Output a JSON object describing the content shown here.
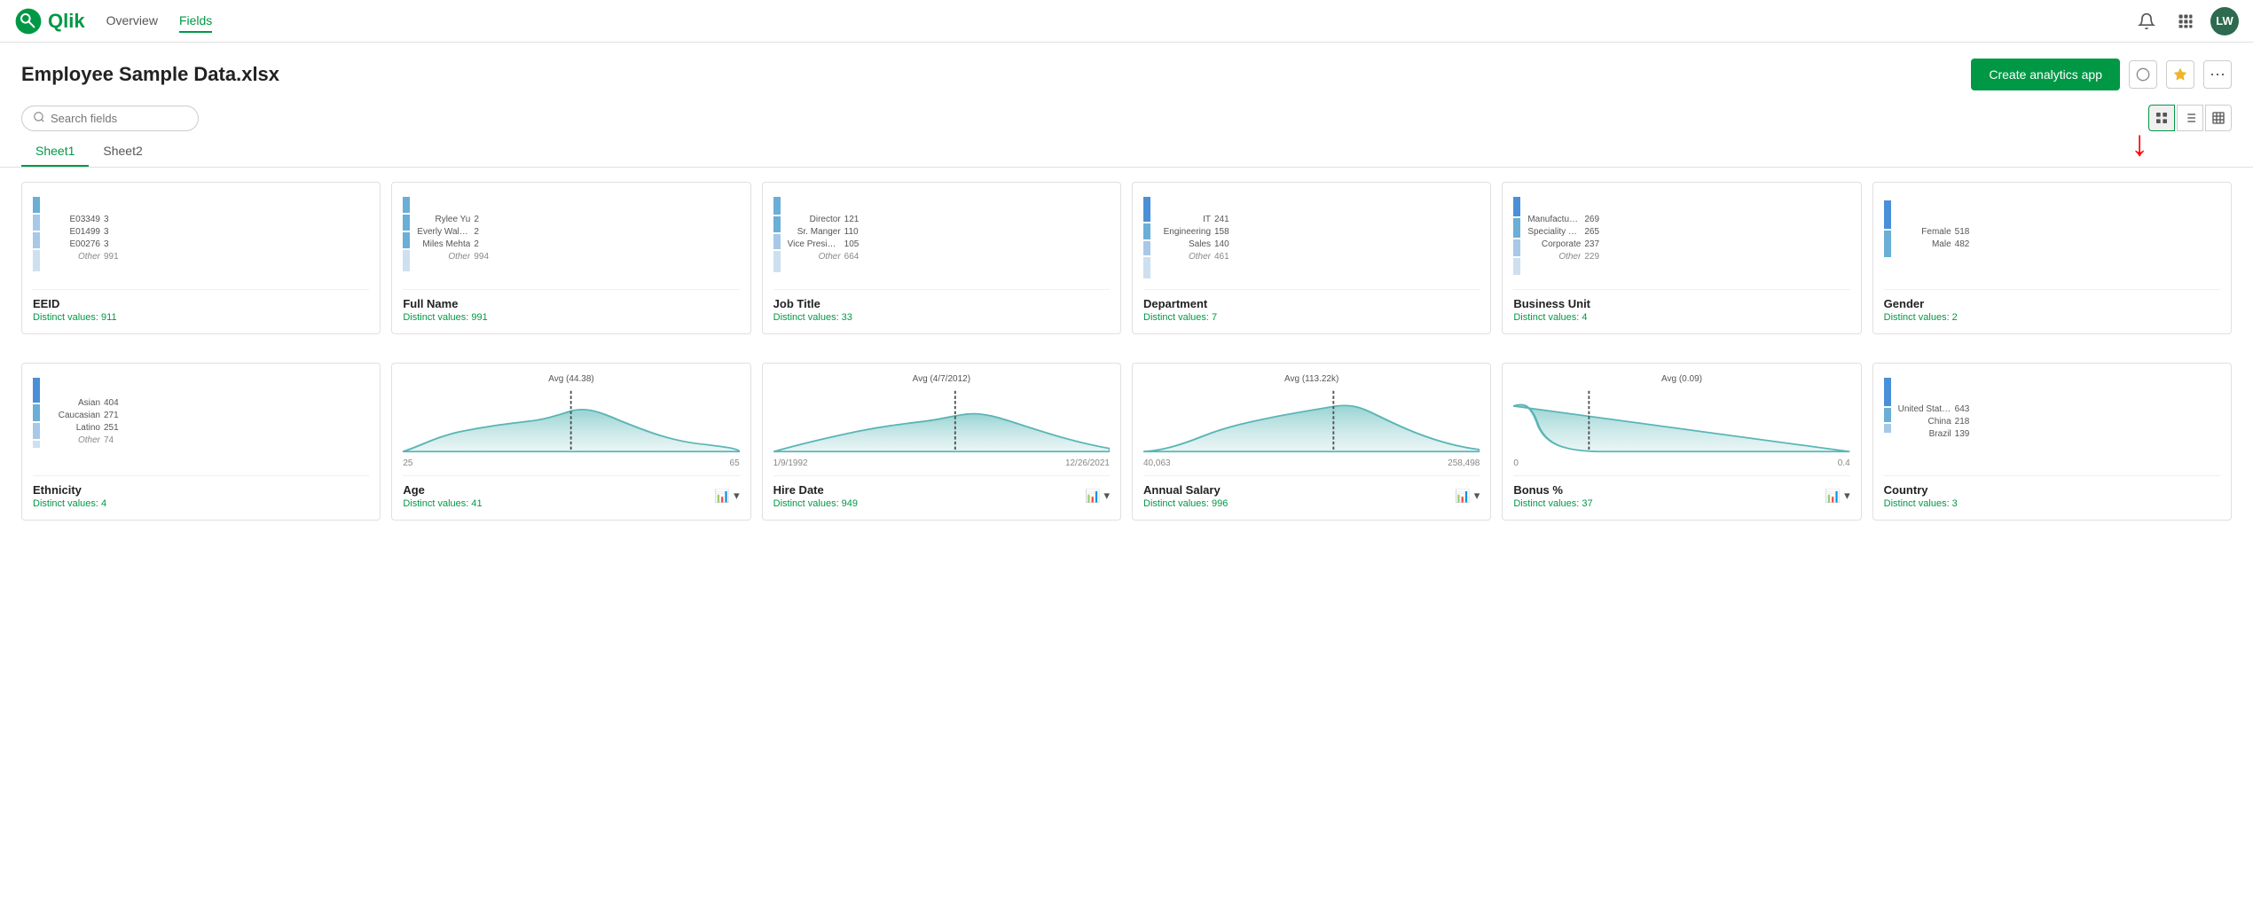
{
  "header": {
    "logo_text": "Qlik",
    "nav_items": [
      {
        "label": "Overview",
        "active": false
      },
      {
        "label": "Fields",
        "active": true
      }
    ],
    "avatar_initials": "LW"
  },
  "title_bar": {
    "title": "Employee Sample Data.xlsx",
    "create_btn": "Create analytics app",
    "more_label": "..."
  },
  "search": {
    "placeholder": "Search fields"
  },
  "tabs": [
    {
      "label": "Sheet1",
      "active": true
    },
    {
      "label": "Sheet2",
      "active": false
    }
  ],
  "view_buttons": [
    "grid",
    "list",
    "table"
  ],
  "cards_row1": [
    {
      "id": "eeid",
      "title": "EEID",
      "distinct": "Distinct values: 911",
      "bars": [
        {
          "label": "E03349",
          "value": "3",
          "pct": 0.3
        },
        {
          "label": "E01499",
          "value": "3",
          "pct": 0.3
        },
        {
          "label": "E00276",
          "value": "3",
          "pct": 0.3
        },
        {
          "label": "Other",
          "value": "991",
          "pct": 0.95
        }
      ]
    },
    {
      "id": "full_name",
      "title": "Full Name",
      "distinct": "Distinct values: 991",
      "bars": [
        {
          "label": "Rylee Yu",
          "value": "2",
          "pct": 0.2
        },
        {
          "label": "Everly Walker",
          "value": "2",
          "pct": 0.2
        },
        {
          "label": "Miles Mehta",
          "value": "2",
          "pct": 0.2
        },
        {
          "label": "Other",
          "value": "994",
          "pct": 0.95
        }
      ]
    },
    {
      "id": "job_title",
      "title": "Job Title",
      "distinct": "Distinct values: 33",
      "bars": [
        {
          "label": "Director",
          "value": "121",
          "pct": 0.7
        },
        {
          "label": "Sr. Manger",
          "value": "110",
          "pct": 0.63
        },
        {
          "label": "Vice President",
          "value": "105",
          "pct": 0.6
        },
        {
          "label": "Other",
          "value": "664",
          "pct": 0.95
        }
      ]
    },
    {
      "id": "department",
      "title": "Department",
      "distinct": "Distinct values: 7",
      "bars": [
        {
          "label": "IT",
          "value": "241",
          "pct": 0.85
        },
        {
          "label": "Engineering",
          "value": "158",
          "pct": 0.56
        },
        {
          "label": "Sales",
          "value": "140",
          "pct": 0.5
        },
        {
          "label": "Other",
          "value": "461",
          "pct": 0.95
        }
      ]
    },
    {
      "id": "business_unit",
      "title": "Business Unit",
      "distinct": "Distinct values: 4",
      "bars": [
        {
          "label": "Manufacturing",
          "value": "269",
          "pct": 0.9
        },
        {
          "label": "Speciality Products",
          "value": "265",
          "pct": 0.88
        },
        {
          "label": "Corporate",
          "value": "237",
          "pct": 0.79
        },
        {
          "label": "Other",
          "value": "229",
          "pct": 0.76
        }
      ]
    },
    {
      "id": "gender",
      "title": "Gender",
      "distinct": "Distinct values: 2",
      "bars": [
        {
          "label": "Female",
          "value": "518",
          "pct": 0.9
        },
        {
          "label": "Male",
          "value": "482",
          "pct": 0.84
        }
      ]
    }
  ],
  "cards_row2": [
    {
      "id": "ethnicity",
      "title": "Ethnicity",
      "distinct": "Distinct values: 4",
      "bars": [
        {
          "label": "Asian",
          "value": "404",
          "pct": 0.95
        },
        {
          "label": "Caucasian",
          "value": "271",
          "pct": 0.64
        },
        {
          "label": "Latino",
          "value": "251",
          "pct": 0.59
        },
        {
          "label": "Other",
          "value": "74",
          "pct": 0.17
        }
      ]
    },
    {
      "id": "age",
      "title": "Age",
      "distinct": "Distinct values: 41",
      "avg_label": "Avg (44.38)",
      "axis_min": "25",
      "axis_max": "65"
    },
    {
      "id": "hire_date",
      "title": "Hire Date",
      "distinct": "Distinct values: 949",
      "avg_label": "Avg (4/7/2012)",
      "axis_min": "1/9/1992",
      "axis_max": "12/26/2021"
    },
    {
      "id": "annual_salary",
      "title": "Annual Salary",
      "distinct": "Distinct values: 996",
      "avg_label": "Avg (113.22k)",
      "axis_min": "40,063",
      "axis_max": "258,498"
    },
    {
      "id": "bonus_pct",
      "title": "Bonus %",
      "distinct": "Distinct values: 37",
      "avg_label": "Avg (0.09)",
      "axis_min": "0",
      "axis_max": "0.4"
    },
    {
      "id": "country",
      "title": "Country",
      "distinct": "Distinct values: 3",
      "bars": [
        {
          "label": "United States",
          "value": "643",
          "pct": 0.95
        },
        {
          "label": "China",
          "value": "218",
          "pct": 0.34
        },
        {
          "label": "Brazil",
          "value": "139",
          "pct": 0.22
        }
      ]
    }
  ]
}
